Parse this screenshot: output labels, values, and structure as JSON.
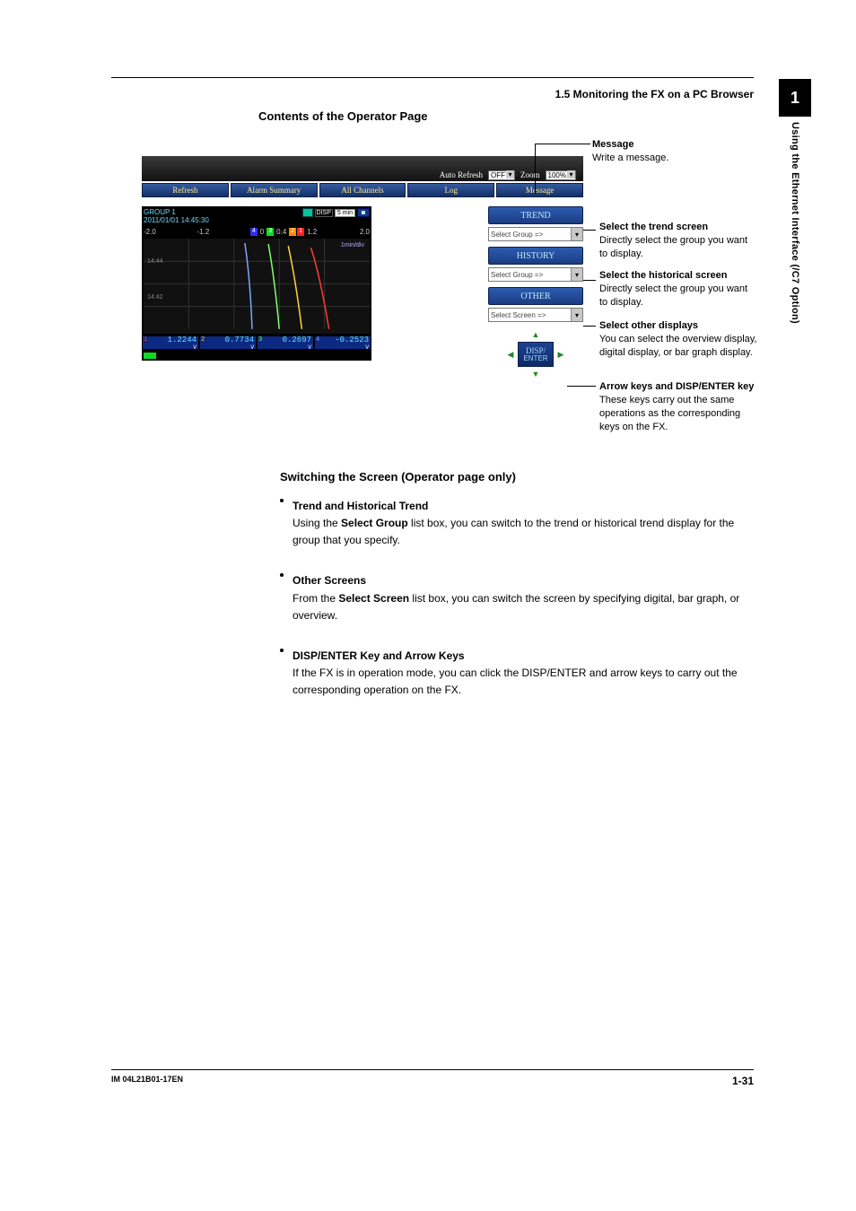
{
  "header": {
    "section": "1.5  Monitoring the FX on a PC Browser"
  },
  "sidetab": {
    "num": "1",
    "label": "Using the Ethernet Interface (/C7 Option)"
  },
  "title": "Contents of the Operator Page",
  "shot": {
    "autoRefreshLabel": "Auto Refresh",
    "autoRefreshValue": "OFF",
    "zoomLabel": "Zoom",
    "zoomValue": "100%",
    "tabs": [
      "Refresh",
      "Alarm Summary",
      "All Channels",
      "Log",
      "Message"
    ],
    "fx": {
      "group": "GROUP 1",
      "timestamp": "2011/01/01 14:45:30",
      "dispLabel": "DISP",
      "rate": "5 min",
      "scaleLeft": "-2.0",
      "scaleMid1": "-1.2",
      "scaleMid2": "0.4",
      "scaleMid3": "1.2",
      "scaleRight": "2.0",
      "ylab1": "14:44",
      "ylab2": "14:42",
      "minDiv": "1min/div",
      "tags": [
        {
          "n": "4",
          "c": "#2e2ef0"
        },
        {
          "n": "3",
          "c": "#0bdc22"
        },
        {
          "n": "2",
          "c": "#ff8c00"
        },
        {
          "n": "1",
          "c": "#ff2222"
        }
      ],
      "digits": [
        {
          "ch": "1",
          "val": "1.2244",
          "unit": "V",
          "col": "#ff3a3a"
        },
        {
          "ch": "2",
          "val": "0.7734",
          "unit": "V",
          "col": "#ffd23a"
        },
        {
          "ch": "3",
          "val": "0.2697",
          "unit": "V",
          "col": "#7fff6a"
        },
        {
          "ch": "4",
          "val": "-0.2523",
          "unit": "V",
          "col": "#7aa7ff"
        }
      ]
    },
    "nav": {
      "trend": "TREND",
      "history": "HISTORY",
      "other": "OTHER",
      "selGroup": "Select Group =>",
      "selScreen": "Select Screen =>",
      "dispEnter1": "DISP/",
      "dispEnter2": "ENTER"
    }
  },
  "ann": {
    "msg": {
      "t": "Message",
      "d": "Write a message."
    },
    "trend": {
      "t": "Select the trend screen",
      "d": "Directly select the group you want to display."
    },
    "hist": {
      "t": "Select the historical screen",
      "d": "Directly select the group you want to display."
    },
    "other": {
      "t": "Select other displays",
      "d": "You can select the overview display, digital display, or bar graph display."
    },
    "keys": {
      "t": "Arrow keys and DISP/ENTER key",
      "d": "These keys carry out the same operations as the corresponding keys on the FX."
    }
  },
  "body": {
    "h": "Switching the Screen (Operator page only)",
    "s1t": "Trend and Historical Trend",
    "s1a": "Using the ",
    "s1b": "Select Group",
    "s1c": " list box, you can switch to the trend or historical trend display for the group that you specify.",
    "s2t": "Other Screens",
    "s2a": "From the ",
    "s2b": "Select Screen",
    "s2c": " list box, you can switch the screen by specifying digital, bar graph, or overview.",
    "s3t": "DISP/ENTER Key and Arrow Keys",
    "s3a": "If the FX is in operation mode, you can click the DISP/ENTER and arrow keys to carry out the corresponding operation on the FX."
  },
  "footer": {
    "doc": "IM 04L21B01-17EN",
    "page": "1-31"
  }
}
